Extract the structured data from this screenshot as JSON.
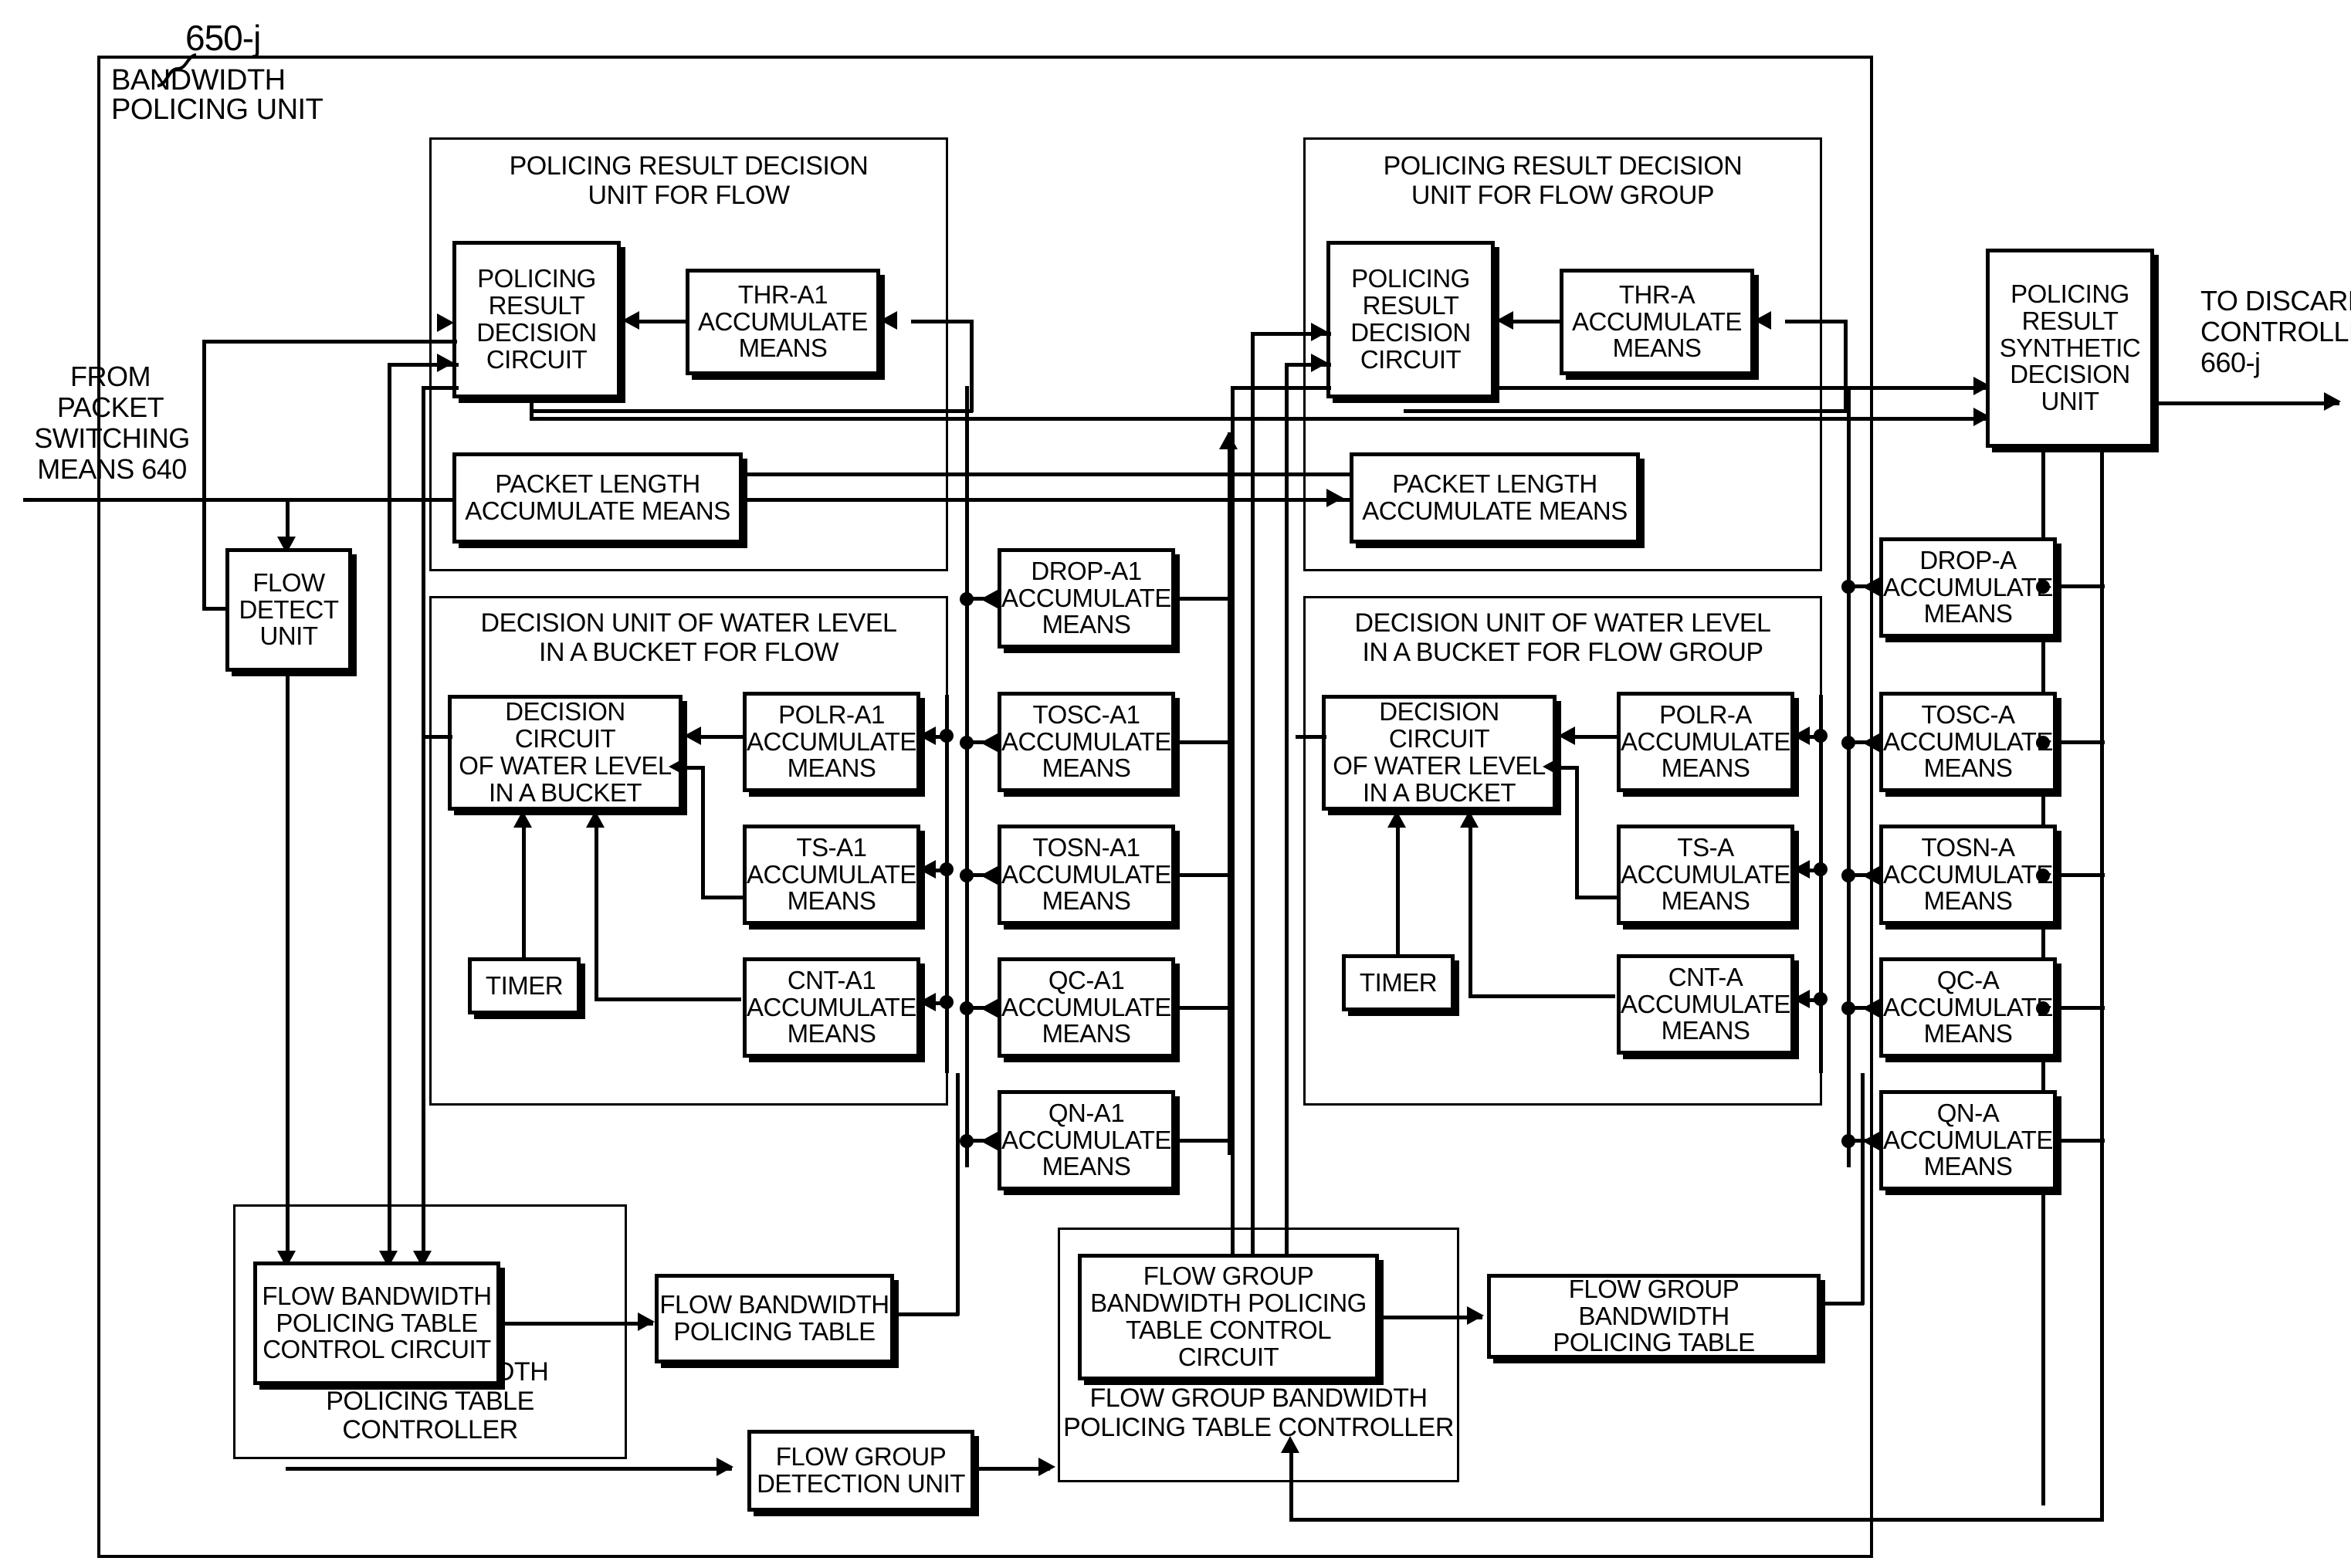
{
  "figure": {
    "reference_label": "650-j",
    "outer_unit_label": "BANDWIDTH\nPOLICING UNIT",
    "outer_unit_label_line1": "BANDWIDTH",
    "outer_unit_label_line2": "POLICING UNIT",
    "input_label_lines": [
      "FROM",
      "PACKET",
      "SWITCHING",
      "MEANS 640"
    ],
    "output_label_lines": [
      "TO DISCARD",
      "CONTROLLER",
      "660-j"
    ]
  },
  "groups": {
    "policing_result_decision_unit_flow": {
      "title_line1": "POLICING RESULT DECISION",
      "title_line2": "UNIT FOR FLOW"
    },
    "policing_result_decision_unit_flow_group": {
      "title_line1": "POLICING RESULT DECISION",
      "title_line2": "UNIT FOR FLOW GROUP"
    },
    "water_level_flow": {
      "title_line1": "DECISION UNIT OF WATER LEVEL",
      "title_line2": "IN A BUCKET FOR FLOW"
    },
    "water_level_flow_group": {
      "title_line1": "DECISION UNIT OF WATER LEVEL",
      "title_line2": "IN A BUCKET FOR FLOW GROUP"
    },
    "flow_bw_table_controller": {
      "title_line1": "FLOW BANDWIDTH",
      "title_line2": "POLICING TABLE CONTROLLER"
    },
    "flow_group_bw_table_controller": {
      "title_line1": "FLOW GROUP BANDWIDTH",
      "title_line2": "POLICING TABLE CONTROLLER"
    }
  },
  "blocks": {
    "policing_result_decision_circuit_flow": {
      "lines": [
        "POLICING",
        "RESULT",
        "DECISION",
        "CIRCUIT"
      ]
    },
    "thr_a1_accumulate_means": {
      "lines": [
        "THR-A1",
        "ACCUMULATE",
        "MEANS"
      ]
    },
    "packet_length_accumulate_means_flow": {
      "lines": [
        "PACKET LENGTH",
        "ACCUMULATE MEANS"
      ]
    },
    "policing_result_decision_circuit_flow_group": {
      "lines": [
        "POLICING",
        "RESULT",
        "DECISION",
        "CIRCUIT"
      ]
    },
    "thr_a_accumulate_means": {
      "lines": [
        "THR-A",
        "ACCUMULATE",
        "MEANS"
      ]
    },
    "packet_length_accumulate_means_flow_group": {
      "lines": [
        "PACKET LENGTH",
        "ACCUMULATE MEANS"
      ]
    },
    "policing_result_synthetic_decision_unit": {
      "lines": [
        "POLICING",
        "RESULT",
        "SYNTHETIC",
        "DECISION",
        "UNIT"
      ]
    },
    "flow_detect_unit": {
      "lines": [
        "FLOW",
        "DETECT",
        "UNIT"
      ]
    },
    "decision_circuit_water_level_flow": {
      "lines": [
        "DECISION CIRCUIT",
        "OF WATER LEVEL",
        "IN A BUCKET"
      ]
    },
    "decision_circuit_water_level_flow_group": {
      "lines": [
        "DECISION CIRCUIT",
        "OF WATER LEVEL",
        "IN A BUCKET"
      ]
    },
    "timer_flow": {
      "lines": [
        "TIMER"
      ]
    },
    "timer_flow_group": {
      "lines": [
        "TIMER"
      ]
    },
    "flow_bw_policing_table_control_circuit": {
      "lines": [
        "FLOW BANDWIDTH",
        "POLICING TABLE",
        "CONTROL CIRCUIT"
      ]
    },
    "flow_bw_policing_table": {
      "lines": [
        "FLOW BANDWIDTH",
        "POLICING TABLE"
      ]
    },
    "flow_group_detection_unit": {
      "lines": [
        "FLOW GROUP",
        "DETECTION UNIT"
      ]
    },
    "flow_group_bw_policing_table_control_circuit": {
      "lines": [
        "FLOW GROUP",
        "BANDWIDTH POLICING",
        "TABLE CONTROL CIRCUIT"
      ]
    },
    "flow_group_bw_policing_table": {
      "lines": [
        "FLOW GROUP BANDWIDTH",
        "POLICING TABLE"
      ]
    }
  },
  "accumulate_columns": {
    "flow_inner": [
      {
        "lines": [
          "POLR-A1",
          "ACCUMULATE",
          "MEANS"
        ]
      },
      {
        "lines": [
          "TS-A1",
          "ACCUMULATE",
          "MEANS"
        ]
      },
      {
        "lines": [
          "CNT-A1",
          "ACCUMULATE",
          "MEANS"
        ]
      }
    ],
    "flow_outer": [
      {
        "lines": [
          "DROP-A1",
          "ACCUMULATE",
          "MEANS"
        ]
      },
      {
        "lines": [
          "TOSC-A1",
          "ACCUMULATE",
          "MEANS"
        ]
      },
      {
        "lines": [
          "TOSN-A1",
          "ACCUMULATE",
          "MEANS"
        ]
      },
      {
        "lines": [
          "QC-A1",
          "ACCUMULATE",
          "MEANS"
        ]
      },
      {
        "lines": [
          "QN-A1",
          "ACCUMULATE",
          "MEANS"
        ]
      }
    ],
    "flow_group_inner": [
      {
        "lines": [
          "POLR-A",
          "ACCUMULATE",
          "MEANS"
        ]
      },
      {
        "lines": [
          "TS-A",
          "ACCUMULATE",
          "MEANS"
        ]
      },
      {
        "lines": [
          "CNT-A",
          "ACCUMULATE",
          "MEANS"
        ]
      }
    ],
    "flow_group_outer": [
      {
        "lines": [
          "DROP-A",
          "ACCUMULATE",
          "MEANS"
        ]
      },
      {
        "lines": [
          "TOSC-A",
          "ACCUMULATE",
          "MEANS"
        ]
      },
      {
        "lines": [
          "TOSN-A",
          "ACCUMULATE",
          "MEANS"
        ]
      },
      {
        "lines": [
          "QC-A",
          "ACCUMULATE",
          "MEANS"
        ]
      },
      {
        "lines": [
          "QN-A",
          "ACCUMULATE",
          "MEANS"
        ]
      }
    ]
  },
  "colors": {
    "ink": "#000000",
    "paper": "#ffffff"
  }
}
